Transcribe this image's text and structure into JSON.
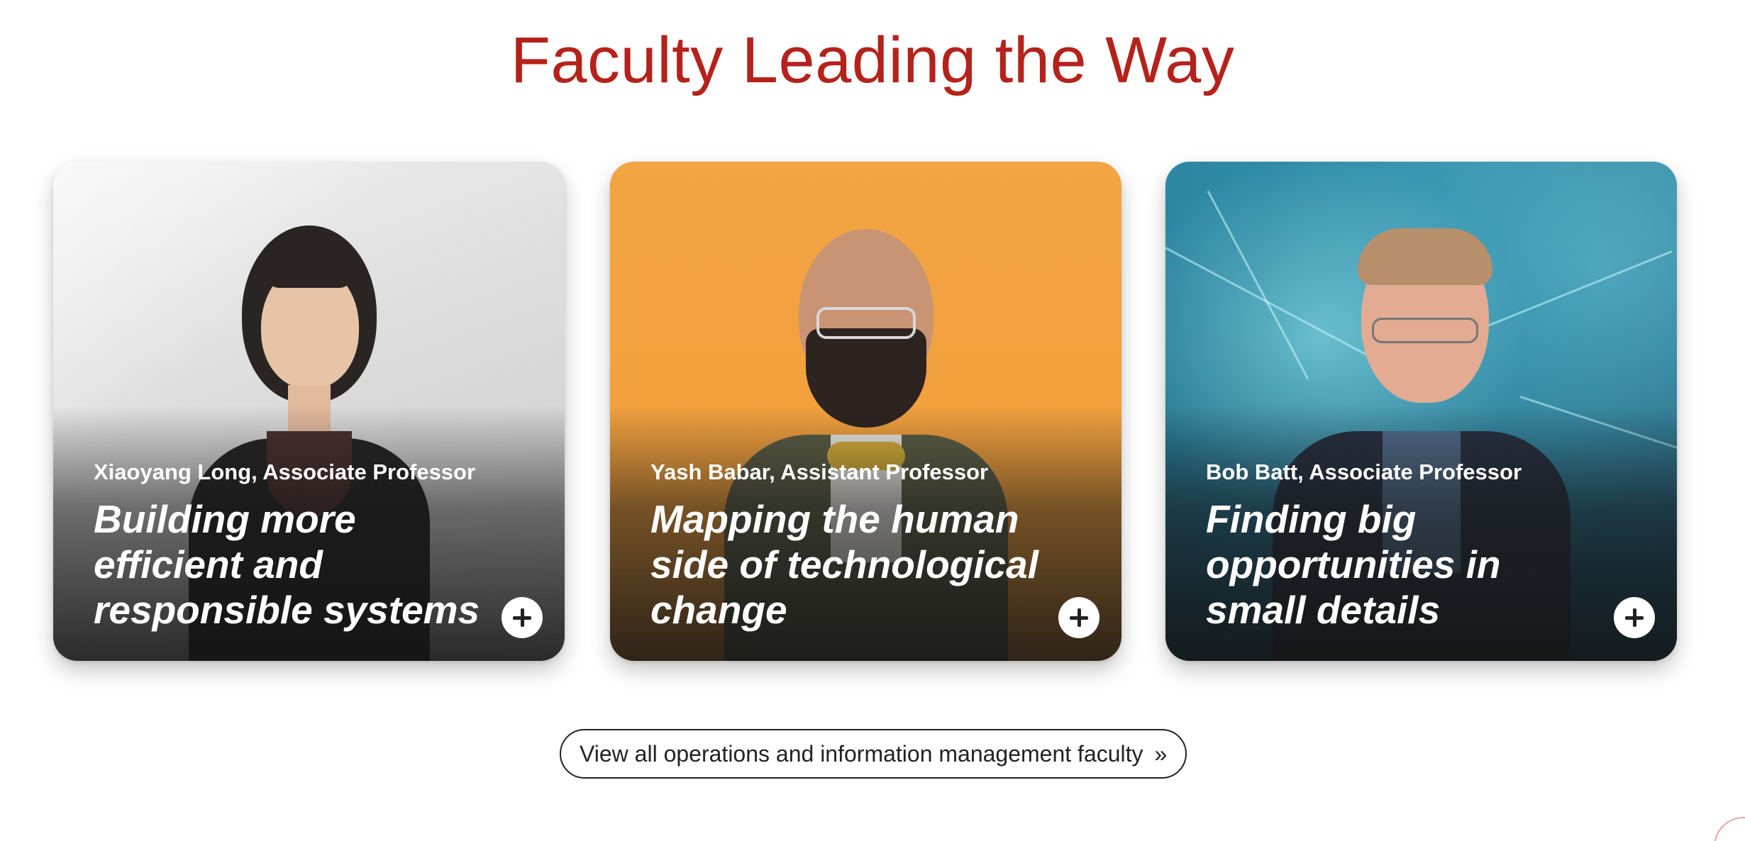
{
  "section": {
    "title": "Faculty Leading the Way"
  },
  "cards": [
    {
      "name": "Xiaoyang Long, Associate Professor",
      "headline": "Building more efficient and responsible systems",
      "expand_icon": "plus-icon"
    },
    {
      "name": "Yash Babar, Assistant Professor",
      "headline": "Mapping the human side of technological change",
      "expand_icon": "plus-icon"
    },
    {
      "name": "Bob Batt, Associate Professor",
      "headline": "Finding big opportunities in small details",
      "expand_icon": "plus-icon"
    }
  ],
  "cta": {
    "label": "View all operations and information management faculty",
    "chevron": "»"
  },
  "colors": {
    "title": "#b5221b",
    "card2_background": "#f2a33f",
    "text_on_card": "#ffffff"
  }
}
